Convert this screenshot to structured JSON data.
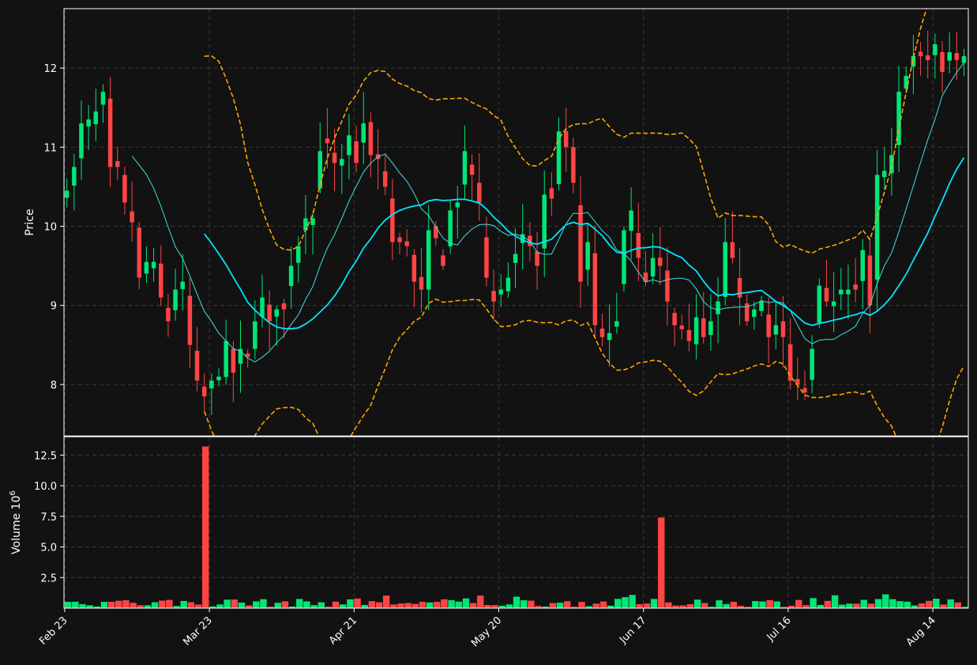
{
  "chart_data": {
    "type": "candlestick",
    "theme": {
      "background": "#121212",
      "frame": "#ffffff",
      "grid": "#3a3a3a",
      "up": "#00e676",
      "down": "#ff4444",
      "ma_fast": "#40e0e0",
      "ma_slow": "#00e5ff",
      "bands": "#ffa500",
      "text": "#ffffff"
    },
    "price_panel": {
      "ylabel": "Price",
      "ylim": [
        7.35,
        12.75
      ],
      "yticks": [
        8,
        9,
        10,
        11,
        12
      ]
    },
    "volume_panel": {
      "ylabel": "Volume",
      "multiplier_label": "10",
      "multiplier_exp": "6",
      "ylim": [
        0,
        14.0
      ],
      "yticks": [
        2.5,
        5.0,
        7.5,
        10.0,
        12.5
      ],
      "ytick_labels": [
        "2.5",
        "5.0",
        "7.5",
        "10.0",
        "12.5"
      ]
    },
    "xticks": [
      {
        "index": 0,
        "label": "Feb 23"
      },
      {
        "index": 20,
        "label": "Mar 23"
      },
      {
        "index": 40,
        "label": "Apr 21"
      },
      {
        "index": 60,
        "label": "May 20"
      },
      {
        "index": 80,
        "label": "Jun 17"
      },
      {
        "index": 100,
        "label": "Jul 16"
      },
      {
        "index": 120,
        "label": "Aug 14"
      }
    ],
    "close_points": [
      [
        0,
        10.45
      ],
      [
        1,
        10.75
      ],
      [
        2,
        11.3
      ],
      [
        3,
        11.35
      ],
      [
        4,
        11.45
      ],
      [
        5,
        11.7
      ],
      [
        6,
        10.75
      ],
      [
        7,
        10.75
      ],
      [
        8,
        10.3
      ],
      [
        9,
        10.05
      ],
      [
        10,
        9.35
      ],
      [
        11,
        9.55
      ],
      [
        12,
        9.55
      ],
      [
        13,
        9.1
      ],
      [
        14,
        8.8
      ],
      [
        15,
        9.2
      ],
      [
        16,
        9.3
      ],
      [
        17,
        8.5
      ],
      [
        18,
        8.05
      ],
      [
        19,
        7.85
      ],
      [
        20,
        8.05
      ],
      [
        21,
        8.1
      ],
      [
        22,
        8.55
      ],
      [
        23,
        8.15
      ],
      [
        24,
        8.45
      ],
      [
        25,
        8.35
      ],
      [
        26,
        8.8
      ],
      [
        27,
        9.1
      ],
      [
        28,
        8.8
      ],
      [
        29,
        8.95
      ],
      [
        30,
        8.95
      ],
      [
        31,
        9.5
      ],
      [
        32,
        9.75
      ],
      [
        33,
        10.1
      ],
      [
        34,
        10.1
      ],
      [
        35,
        10.95
      ],
      [
        36,
        11.05
      ],
      [
        37,
        10.8
      ],
      [
        38,
        10.85
      ],
      [
        39,
        11.15
      ],
      [
        40,
        10.8
      ],
      [
        41,
        11.3
      ],
      [
        42,
        10.9
      ],
      [
        43,
        10.85
      ],
      [
        44,
        10.5
      ],
      [
        45,
        9.8
      ],
      [
        46,
        9.8
      ],
      [
        47,
        9.75
      ],
      [
        48,
        9.3
      ],
      [
        49,
        9.2
      ],
      [
        50,
        9.95
      ],
      [
        51,
        9.85
      ],
      [
        52,
        9.5
      ],
      [
        53,
        10.2
      ],
      [
        54,
        10.3
      ],
      [
        55,
        10.95
      ],
      [
        56,
        10.65
      ],
      [
        57,
        10.3
      ],
      [
        58,
        9.35
      ],
      [
        59,
        9.05
      ],
      [
        60,
        9.2
      ],
      [
        61,
        9.35
      ],
      [
        62,
        9.65
      ],
      [
        63,
        9.9
      ],
      [
        64,
        9.75
      ],
      [
        65,
        9.5
      ],
      [
        66,
        10.4
      ],
      [
        67,
        10.35
      ],
      [
        68,
        11.2
      ],
      [
        69,
        11.0
      ],
      [
        70,
        10.55
      ],
      [
        71,
        9.3
      ],
      [
        72,
        9.8
      ],
      [
        73,
        8.75
      ],
      [
        74,
        8.6
      ],
      [
        75,
        8.65
      ],
      [
        76,
        8.8
      ],
      [
        77,
        9.95
      ],
      [
        78,
        10.2
      ],
      [
        79,
        9.6
      ],
      [
        80,
        9.3
      ],
      [
        81,
        9.6
      ],
      [
        82,
        9.5
      ],
      [
        83,
        9.05
      ],
      [
        84,
        8.75
      ],
      [
        85,
        8.7
      ],
      [
        86,
        8.55
      ],
      [
        87,
        8.85
      ],
      [
        88,
        8.6
      ],
      [
        89,
        8.8
      ],
      [
        90,
        9.05
      ],
      [
        91,
        9.8
      ],
      [
        92,
        9.6
      ],
      [
        93,
        9.1
      ],
      [
        94,
        8.8
      ],
      [
        95,
        8.95
      ],
      [
        96,
        9.05
      ],
      [
        97,
        8.6
      ],
      [
        98,
        8.75
      ],
      [
        99,
        8.6
      ],
      [
        100,
        8.05
      ],
      [
        101,
        8.0
      ],
      [
        102,
        7.9
      ],
      [
        103,
        8.45
      ],
      [
        104,
        9.25
      ],
      [
        105,
        9.05
      ],
      [
        106,
        9.05
      ],
      [
        107,
        9.2
      ],
      [
        108,
        9.2
      ],
      [
        109,
        9.2
      ],
      [
        110,
        9.7
      ],
      [
        111,
        9.0
      ],
      [
        112,
        10.65
      ],
      [
        113,
        10.7
      ],
      [
        114,
        10.9
      ],
      [
        115,
        11.7
      ],
      [
        116,
        11.9
      ],
      [
        117,
        12.15
      ],
      [
        118,
        12.15
      ],
      [
        119,
        12.1
      ],
      [
        120,
        12.3
      ],
      [
        121,
        11.95
      ],
      [
        122,
        12.2
      ],
      [
        123,
        12.1
      ],
      [
        124,
        12.15
      ]
    ],
    "volume_spikes": [
      {
        "index": 19,
        "value": 13.2
      },
      {
        "index": 82,
        "value": 7.4
      }
    ],
    "volume_base_range": [
      0.1,
      1.2
    ],
    "ma_fast_window": 10,
    "ma_slow_window": 20,
    "band_width_std": 2
  }
}
